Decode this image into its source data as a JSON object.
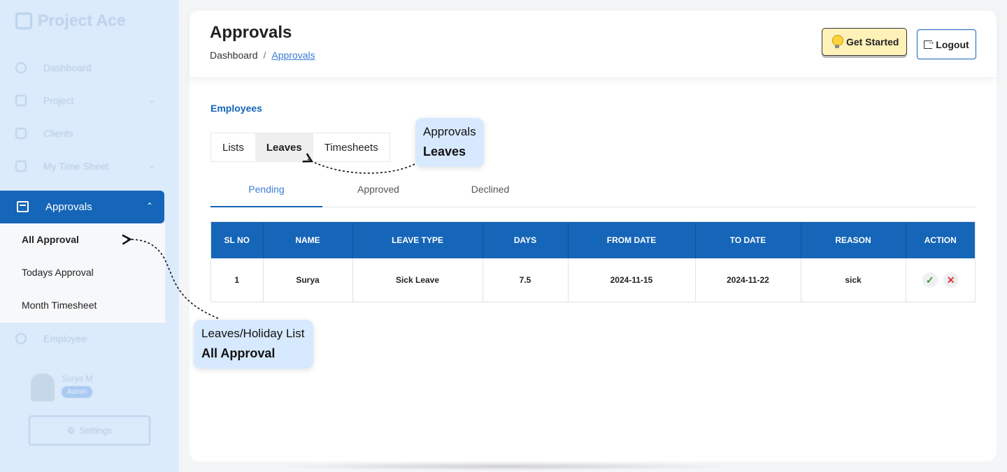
{
  "app": {
    "name": "Project Ace"
  },
  "sidebar": {
    "items": [
      {
        "label": "Dashboard",
        "icon": "dashboard-icon"
      },
      {
        "label": "Project",
        "icon": "folder-icon"
      },
      {
        "label": "Clients",
        "icon": "clients-icon"
      },
      {
        "label": "My Time Sheet",
        "icon": "timesheet-icon"
      },
      {
        "label": "Approvals",
        "icon": "calendar-icon"
      },
      {
        "label": "Employee",
        "icon": "user-icon"
      }
    ],
    "submenu": [
      "All Approval",
      "Todays Approval",
      "Month Timesheet"
    ],
    "user": {
      "name": "Surya M",
      "role": "Admin"
    },
    "settings_label": "Settings"
  },
  "header": {
    "title": "Approvals",
    "breadcrumb": [
      "Dashboard",
      "/",
      "Approvals"
    ],
    "get_started": "Get Started",
    "logout": "Logout"
  },
  "content": {
    "section_label": "Employees",
    "tabs": [
      "Lists",
      "Leaves",
      "Timesheets"
    ],
    "active_tab": "Leaves",
    "subtabs": [
      "Pending",
      "Approved",
      "Declined"
    ],
    "active_subtab": "Pending",
    "table": {
      "columns": [
        "SL NO",
        "NAME",
        "LEAVE TYPE",
        "DAYS",
        "FROM DATE",
        "TO DATE",
        "REASON",
        "ACTION"
      ],
      "rows": [
        [
          "1",
          "Surya",
          "Sick Leave",
          "7.5",
          "2024-11-15",
          "2024-11-22",
          "sick"
        ]
      ]
    }
  },
  "callouts": {
    "top": {
      "line1": "Approvals",
      "line2": "Leaves"
    },
    "bottom": {
      "line1": "Leaves/Holiday List",
      "line2": "All Approval"
    }
  },
  "colors": {
    "primary": "#1565b8",
    "sidebar_bg": "#dcebfb",
    "callout_bg": "#d7e9ff",
    "get_started_bg": "#fff1b8"
  }
}
